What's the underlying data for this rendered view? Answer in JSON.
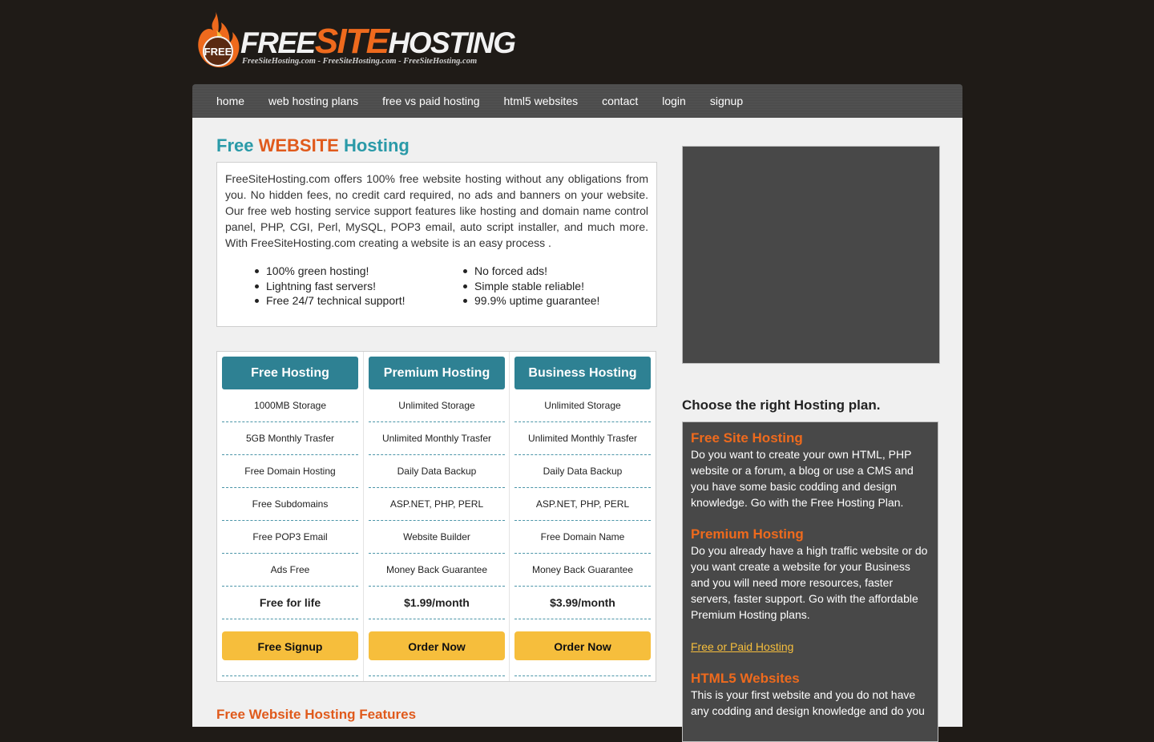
{
  "logo": {
    "word_1": "FREE",
    "word_2": "SITE",
    "word_3": "HOSTING",
    "badge": "FREE",
    "tagline": "FreeSiteHosting.com - FreeSiteHosting.com - FreeSiteHosting.com"
  },
  "nav": {
    "items": [
      "home",
      "web hosting plans",
      "free vs paid hosting",
      "html5 websites",
      "contact",
      "login",
      "signup"
    ]
  },
  "main": {
    "title_part1": "Free",
    "title_part2": "WEBSITE",
    "title_part3": "Hosting",
    "intro": "FreeSiteHosting.com offers 100% free website hosting without any obligations from you. No hidden fees, no credit card required, no ads and banners on your website. Our free web hosting service support features like hosting and domain name control panel, PHP, CGI, Perl, MySQL, POP3 email, auto script installer, and much more. With FreeSiteHosting.com creating a website is an easy process .",
    "bullets_left": [
      "100% green hosting!",
      "Lightning fast servers!",
      "Free 24/7 technical support!"
    ],
    "bullets_right": [
      "No forced ads!",
      "Simple stable reliable!",
      "99.9% uptime guarantee!"
    ],
    "features_heading": "Free Website Hosting Features"
  },
  "plans": [
    {
      "name": "Free Hosting",
      "features": [
        "1000MB Storage",
        "5GB Monthly Trasfer",
        "Free Domain Hosting",
        "Free Subdomains",
        "Free POP3 Email",
        "Ads Free"
      ],
      "price": "Free for life",
      "button": "Free Signup"
    },
    {
      "name": "Premium Hosting",
      "features": [
        "Unlimited Storage",
        "Unlimited Monthly Trasfer",
        "Daily Data Backup",
        "ASP.NET, PHP, PERL",
        "Website Builder",
        "Money Back Guarantee"
      ],
      "price": "$1.99/month",
      "button": "Order Now"
    },
    {
      "name": "Business Hosting",
      "features": [
        "Unlimited Storage",
        "Unlimited Monthly Trasfer",
        "Daily Data Backup",
        "ASP.NET, PHP, PERL",
        "Free Domain Name",
        "Money Back Guarantee"
      ],
      "price": "$3.99/month",
      "button": "Order Now"
    }
  ],
  "sidebar": {
    "choose_heading": "Choose the right Hosting plan.",
    "free_title": "Free Site Hosting",
    "free_desc": "Do you want to create your own HTML, PHP website or a forum, a blog or use a CMS and you have some basic codding and design knowledge. Go with the Free Hosting Plan.",
    "premium_title": "Premium Hosting",
    "premium_desc": "Do you already have a high traffic website or do you want create a website for your Business and you will need more resources, faster servers, faster support. Go with the affordable Premium Hosting plans.",
    "link": "Free or Paid Hosting",
    "html5_title": "HTML5 Websites",
    "html5_desc": "This is your first website and you do not have any codding and design knowledge and do you"
  },
  "colors": {
    "background": "#1f1b17",
    "teal": "#2a9aa8",
    "orange": "#e05a1c",
    "button_yellow": "#f6be3c",
    "plan_header": "#2e8193"
  }
}
